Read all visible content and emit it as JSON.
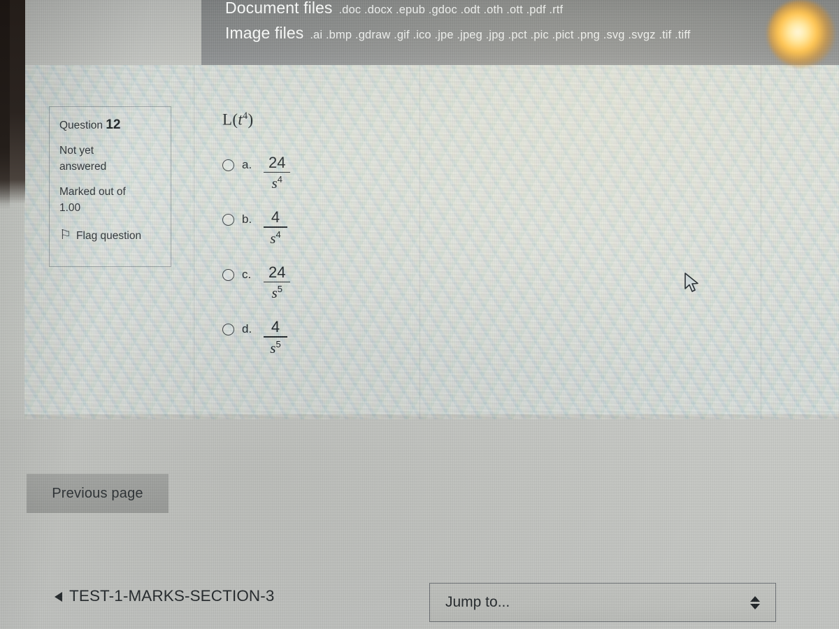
{
  "filetype_panel": {
    "rows": [
      {
        "label": "Document files",
        "extensions": ".doc .docx .epub .gdoc .odt .oth .ott .pdf .rtf"
      },
      {
        "label": "Image files",
        "extensions": ".ai .bmp .gdraw .gif .ico .jpe .jpeg .jpg .pct .pic .pict .png .svg .svgz .tif .tiff"
      }
    ]
  },
  "question_info": {
    "question_word": "Question",
    "question_number": "12",
    "status_line1": "Not yet",
    "status_line2": "answered",
    "marks_line1": "Marked out of",
    "marks_line2": "1.00",
    "flag_icon": "flag-outline-icon",
    "flag_label": "Flag question"
  },
  "question": {
    "stem_prefix": "L(",
    "stem_variable": "t",
    "stem_exponent": "4",
    "stem_suffix": ")",
    "stem_text": "L(t4)",
    "options": [
      {
        "letter": "a.",
        "numerator": "24",
        "denominator_base": "s",
        "denominator_exponent": "4",
        "selected": false
      },
      {
        "letter": "b.",
        "numerator": "4",
        "denominator_base": "s",
        "denominator_exponent": "4",
        "selected": false
      },
      {
        "letter": "c.",
        "numerator": "24",
        "denominator_base": "s",
        "denominator_exponent": "5",
        "selected": false
      },
      {
        "letter": "d.",
        "numerator": "4",
        "denominator_base": "s",
        "denominator_exponent": "5",
        "selected": false
      }
    ]
  },
  "navigation": {
    "previous_page_label": "Previous page",
    "previous_activity_label": "TEST-1-MARKS-SECTION-3",
    "previous_activity_icon": "triangle-left-icon",
    "jump_to_label": "Jump to...",
    "jump_to_arrows_icon": "updown-arrows-icon"
  },
  "cursor": {
    "icon": "mouse-pointer-icon"
  },
  "colors": {
    "panel_background": "#7e8182",
    "panel_text": "#f4f6f7",
    "page_background": "#c6c8c4",
    "content_background": "#dde3df",
    "text_primary": "#23282b",
    "button_background": "#a3a5a2",
    "border": "#6d7175",
    "glare": "#ffc451"
  }
}
